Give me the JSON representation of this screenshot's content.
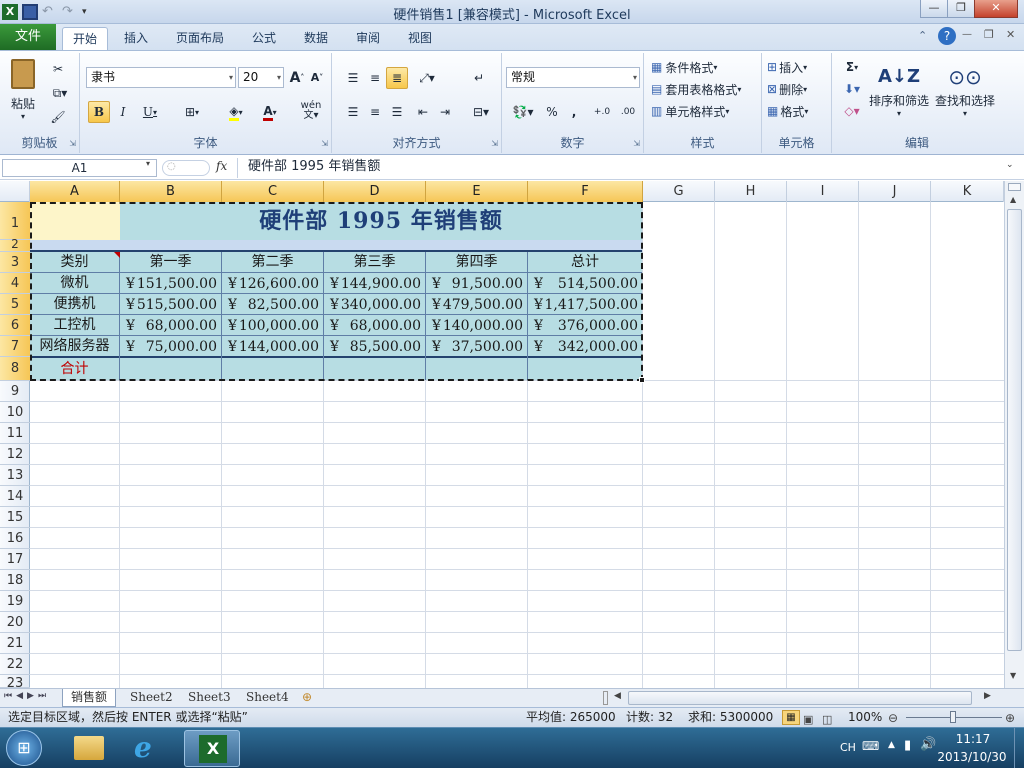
{
  "window": {
    "title": "硬件销售1  [兼容模式]  -  Microsoft Excel",
    "min": "—",
    "max": "❐",
    "close": "✕"
  },
  "ribbon_tabs": {
    "file": "文件",
    "tabs": [
      "开始",
      "插入",
      "页面布局",
      "公式",
      "数据",
      "审阅",
      "视图"
    ]
  },
  "clipboard": {
    "paste": "粘贴",
    "label": "剪贴板"
  },
  "font": {
    "name": "隶书",
    "size": "20",
    "label": "字体",
    "bold": "B",
    "italic": "I",
    "underline": "U",
    "color_a": "A",
    "wen": "wén"
  },
  "alignment": {
    "label": "对齐方式"
  },
  "number": {
    "format": "常规",
    "label": "数字",
    "percent": "%",
    "comma": ",",
    "inc": ".0 .00",
    "dec": ".00 .0"
  },
  "styles": {
    "label": "样式",
    "conditional": "条件格式",
    "table": "套用表格格式",
    "cell": "单元格样式"
  },
  "cells": {
    "label": "单元格",
    "insert": "插入",
    "delete": "删除",
    "format": "格式"
  },
  "editing": {
    "label": "编辑",
    "sum": "Σ",
    "sort": "排序和筛选",
    "find": "查找和选择"
  },
  "formula_bar": {
    "name_box": "A1",
    "fx": "fx",
    "content": "硬件部 1995 年销售额"
  },
  "columns": [
    "A",
    "B",
    "C",
    "D",
    "E",
    "F",
    "G",
    "H",
    "I",
    "J",
    "K"
  ],
  "rows": [
    "1",
    "2",
    "3",
    "4",
    "5",
    "6",
    "7",
    "8",
    "9",
    "10",
    "11",
    "12",
    "13",
    "14",
    "15",
    "16",
    "17",
    "18",
    "19",
    "20",
    "21",
    "22",
    "23"
  ],
  "table": {
    "title": "硬件部  1995  年销售额",
    "headers": [
      "类别",
      "第一季",
      "第二季",
      "第三季",
      "第四季",
      "总计"
    ],
    "currency": "¥",
    "rows": [
      {
        "category": "微机",
        "values": [
          "151,500.00",
          "126,600.00",
          "144,900.00",
          "91,500.00",
          "514,500.00"
        ]
      },
      {
        "category": "便携机",
        "values": [
          "515,500.00",
          "82,500.00",
          "340,000.00",
          "479,500.00",
          "1,417,500.00"
        ]
      },
      {
        "category": "工控机",
        "values": [
          "68,000.00",
          "100,000.00",
          "68,000.00",
          "140,000.00",
          "376,000.00"
        ]
      },
      {
        "category": "网络服务器",
        "values": [
          "75,000.00",
          "144,000.00",
          "85,500.00",
          "37,500.00",
          "342,000.00"
        ]
      }
    ],
    "total_label": "合计"
  },
  "sheet_tabs": [
    "销售额",
    "Sheet2",
    "Sheet3",
    "Sheet4"
  ],
  "status": {
    "message": "选定目标区域，然后按 ENTER 或选择“粘贴”",
    "average": "平均值: 265000",
    "count": "计数: 32",
    "sum": "求和: 5300000",
    "zoom": "100%"
  },
  "taskbar": {
    "lang": "CH",
    "time": "11:17",
    "date": "2013/10/30"
  },
  "colors": {
    "table_fill": "#b7dde3",
    "title_text": "#1f3f78",
    "total_label": "#c00000",
    "file_tab": "#2a7f2f"
  }
}
